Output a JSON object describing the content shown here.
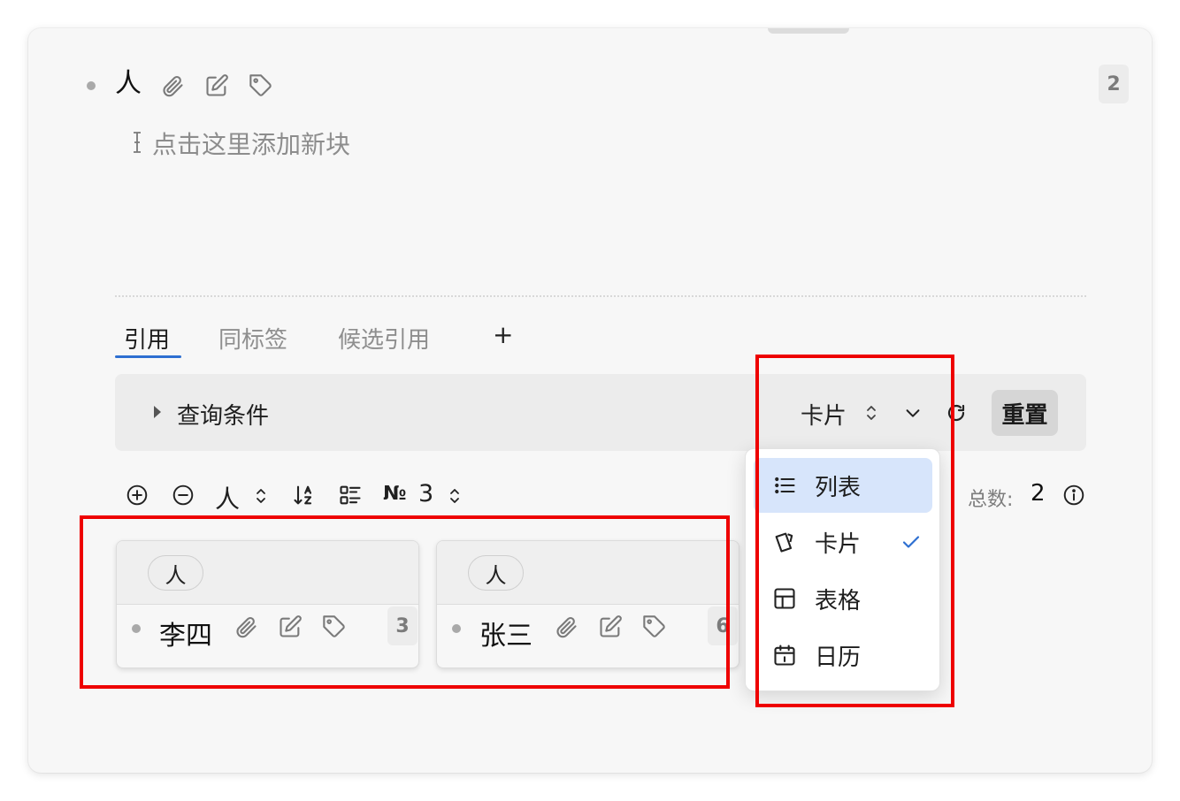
{
  "block": {
    "title": "人",
    "count": "2",
    "placeholder": "点击这里添加新块",
    "icons": [
      "paperclip-icon",
      "pencil-square-icon",
      "tag-icon"
    ]
  },
  "tabs": [
    {
      "label": "引用",
      "active": true
    },
    {
      "label": "同标签",
      "active": false
    },
    {
      "label": "候选引用",
      "active": false
    }
  ],
  "add_tab_label": "+",
  "query_bar": {
    "conditions_label": "查询条件",
    "view_label": "卡片",
    "reset_label": "重置"
  },
  "toolbar": {
    "tag_filter": "人",
    "number_symbol": "№",
    "number_value": "3",
    "total_label": "总数:",
    "total_value": "2"
  },
  "cards": [
    {
      "tag": "人",
      "name": "李四",
      "count": "3"
    },
    {
      "tag": "人",
      "name": "张三",
      "count": "6"
    }
  ],
  "view_menu": {
    "items": [
      {
        "label": "列表",
        "icon": "list-icon",
        "highlighted": true,
        "checked": false
      },
      {
        "label": "卡片",
        "icon": "cards-icon",
        "highlighted": false,
        "checked": true
      },
      {
        "label": "表格",
        "icon": "table-icon",
        "highlighted": false,
        "checked": false
      },
      {
        "label": "日历",
        "icon": "calendar-icon",
        "highlighted": false,
        "checked": false
      }
    ]
  },
  "colors": {
    "accent": "#2d6fd1",
    "highlight": "#d7e5fb",
    "annotation": "#ee0000"
  }
}
